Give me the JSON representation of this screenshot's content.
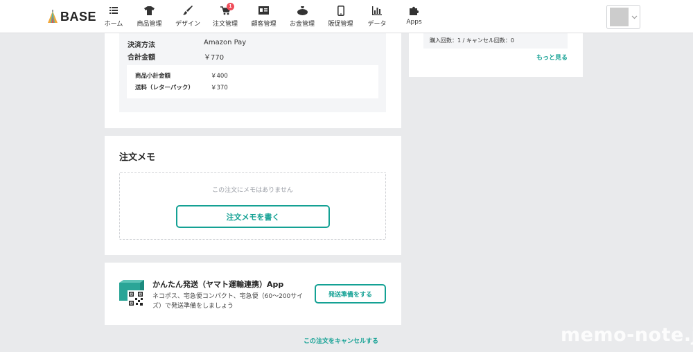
{
  "brand": {
    "logo_text": "BASE",
    "accent_color": "#14a194",
    "badge_color": "#ef4d5a"
  },
  "nav": [
    {
      "label": "ホーム",
      "icon": "home-list-icon"
    },
    {
      "label": "商品管理",
      "icon": "tshirt-icon"
    },
    {
      "label": "デザイン",
      "icon": "brush-icon"
    },
    {
      "label": "注文管理",
      "icon": "cart-icon",
      "badge": "1"
    },
    {
      "label": "顧客管理",
      "icon": "address-card-icon"
    },
    {
      "label": "お金管理",
      "icon": "money-bag-icon"
    },
    {
      "label": "販促管理",
      "icon": "smartphone-icon"
    },
    {
      "label": "データ",
      "icon": "bar-chart-icon"
    },
    {
      "label": "Apps",
      "icon": "puzzle-icon"
    }
  ],
  "payment": {
    "method_label": "決済方法",
    "method_value": "Amazon Pay",
    "total_label": "合計金額",
    "total_value": "￥770",
    "subtotal_label": "商品小計金額",
    "subtotal_value": "￥400",
    "shipping_label": "送料（レターパック）",
    "shipping_value": "￥370"
  },
  "memo": {
    "title": "注文メモ",
    "empty_text": "この注文にメモはありません",
    "write_button": "注文メモを書く"
  },
  "shipping_app": {
    "title": "かんたん発送（ヤマト運輸連携）App",
    "description": "ネコポス、宅急便コンパクト、宅急便（60〜200サイズ）で発送準備をしましょう",
    "button": "発送準備をする"
  },
  "cancel_link": "この注文をキャンセルする",
  "customer": {
    "purchase_stats": "購入回数：1 / キャンセル回数：0",
    "more_link": "もっと見る"
  },
  "watermark": "memo-note.jp"
}
